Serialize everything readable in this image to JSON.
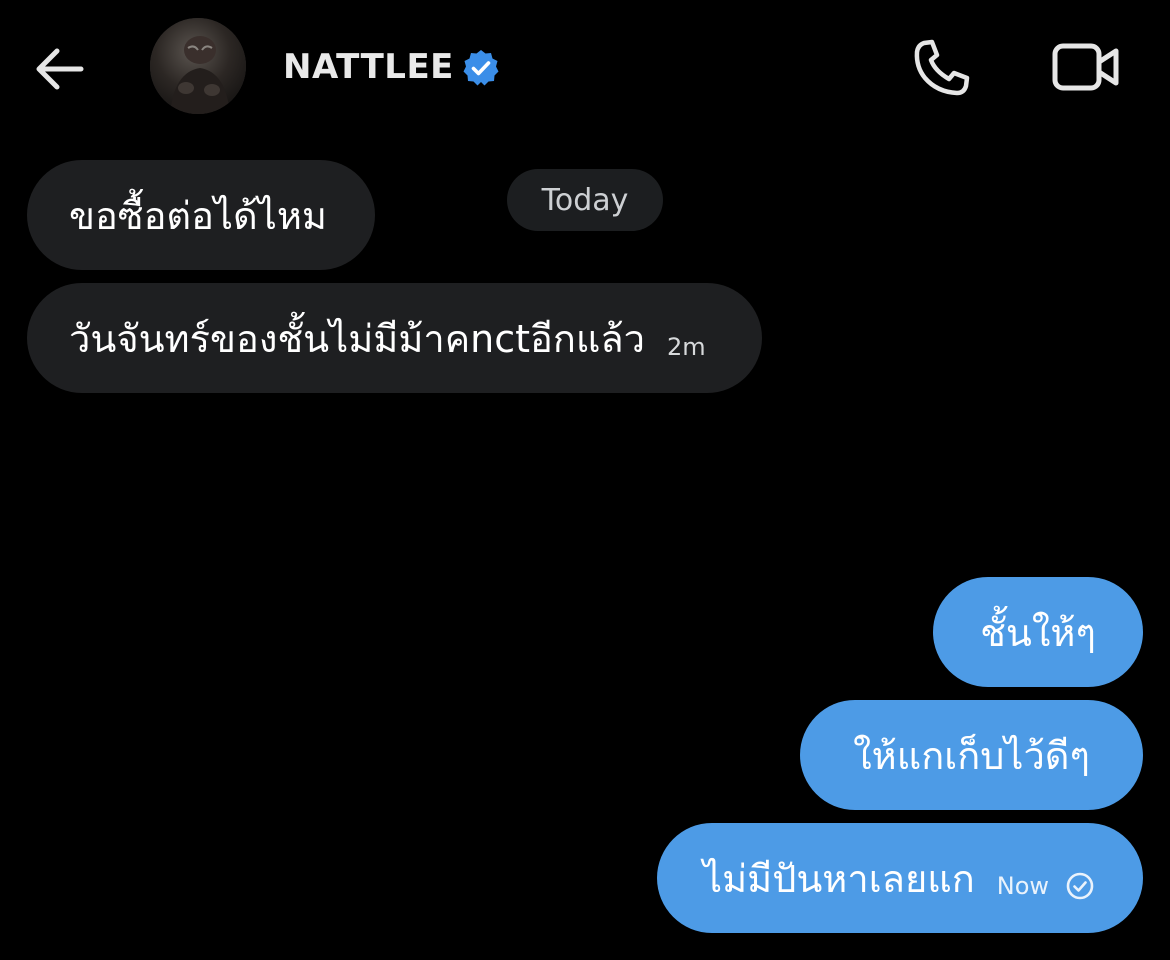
{
  "header": {
    "contact_name": "NATTLEE",
    "back_icon": "arrow-left-icon",
    "verified_icon": "verified-badge-icon",
    "call_icon": "phone-icon",
    "video_icon": "video-camera-icon"
  },
  "date_separator": "Today",
  "messages": [
    {
      "direction": "incoming",
      "text": "ขอซื้อต่อได้ไหม",
      "time": ""
    },
    {
      "direction": "incoming",
      "text": "วันจันทร์ของชั้นไม่มีม้าคnctอีกแล้ว",
      "time": "2m"
    },
    {
      "direction": "outgoing",
      "text": "ชั้นให้ๆ",
      "time": ""
    },
    {
      "direction": "outgoing",
      "text": "ให้แกเก็บไว้ดีๆ",
      "time": ""
    },
    {
      "direction": "outgoing",
      "text": "ไม่มีปันหาเลยแก",
      "time": "Now",
      "status_icon": "sent-check-circle-icon"
    }
  ],
  "colors": {
    "background": "#000000",
    "incoming_bubble": "#1e1f21",
    "outgoing_bubble": "#4d9be6",
    "verified": "#3b8ee8",
    "icon": "#e6e6e6"
  }
}
